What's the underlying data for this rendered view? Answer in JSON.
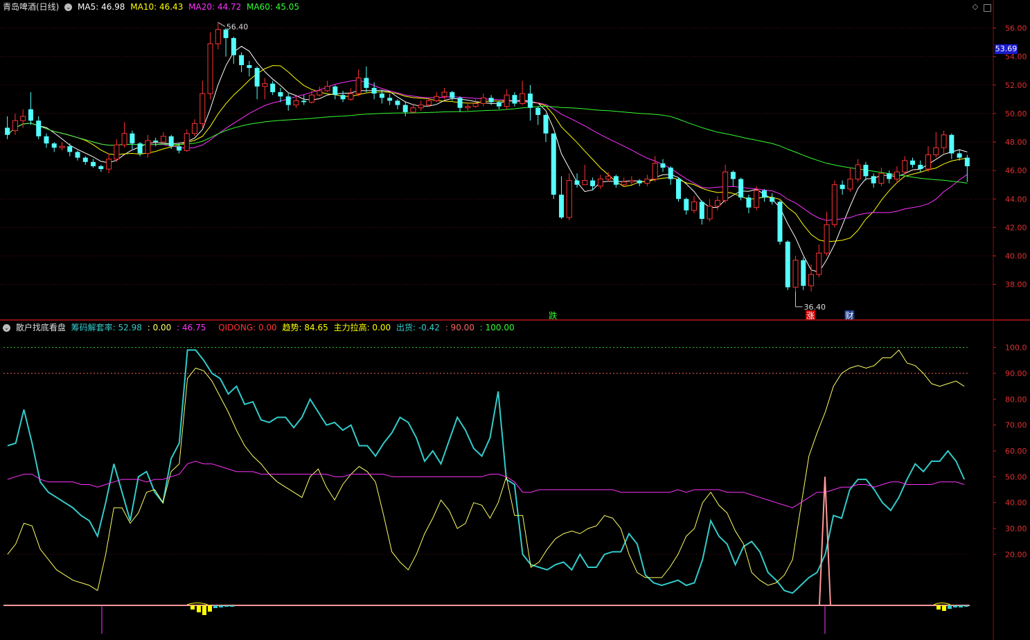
{
  "main": {
    "stock_name": "青岛啤酒(日线)",
    "ma_labels": [
      {
        "text": "MA5: 46.98",
        "color": "#ffffff"
      },
      {
        "text": "MA10: 46.43",
        "color": "#ffff00"
      },
      {
        "text": "MA20: 44.72",
        "color": "#ff33ff"
      },
      {
        "text": "MA60: 45.05",
        "color": "#33ff33"
      }
    ],
    "current_price": "53.69",
    "high_marker": "56.40",
    "low_marker": "36.40",
    "signals": [
      {
        "text": "跌",
        "color": "#33ff33"
      },
      {
        "text": "涨",
        "color": "#ffffff",
        "bg": "#cc0000"
      },
      {
        "text": "财",
        "color": "#ffffff",
        "bg": "#1a3a8a"
      }
    ],
    "y_ticks": [
      "56.00",
      "54.00",
      "52.00",
      "50.00",
      "48.00",
      "46.00",
      "44.00",
      "42.00",
      "40.00",
      "38.00"
    ]
  },
  "indicator": {
    "name": "散户找底看盘",
    "labels": [
      {
        "text": "筹码解套率: 52.98",
        "color": "#33cccc"
      },
      {
        "text": ": 0.00",
        "color": "#ffff66"
      },
      {
        "text": ": 46.75",
        "color": "#ff33ff"
      },
      {
        "text": "QIDONG: 0.00",
        "color": "#ff3333"
      },
      {
        "text": "趋势: 84.65",
        "color": "#ffff00"
      },
      {
        "text": "主力拉高: 0.00",
        "color": "#ffff00"
      },
      {
        "text": "出货: -0.42",
        "color": "#33cccc"
      },
      {
        "text": ": 90.00",
        "color": "#ff6666"
      },
      {
        "text": ": 100.00",
        "color": "#33ff33"
      }
    ],
    "y_ticks": [
      "100.0",
      "90.00",
      "80.00",
      "70.00",
      "60.00",
      "50.00",
      "40.00",
      "30.00",
      "20.00"
    ]
  },
  "chart_data": [
    {
      "type": "candlestick",
      "title": "青岛啤酒(日线)",
      "ylim": [
        35.5,
        57.0
      ],
      "candles": [
        [
          49.0,
          48.5,
          49.8,
          48.2
        ],
        [
          48.8,
          49.5,
          50.0,
          48.5
        ],
        [
          49.5,
          49.8,
          50.3,
          49.0
        ],
        [
          50.3,
          49.5,
          51.5,
          49.2
        ],
        [
          49.5,
          48.4,
          49.8,
          48.2
        ],
        [
          48.4,
          47.9,
          48.6,
          47.6
        ],
        [
          47.9,
          47.6,
          48.0,
          47.3
        ],
        [
          47.6,
          47.7,
          48.0,
          47.4
        ],
        [
          47.7,
          47.3,
          47.9,
          47.0
        ],
        [
          47.3,
          46.9,
          47.4,
          46.7
        ],
        [
          46.9,
          46.6,
          47.0,
          46.4
        ],
        [
          46.6,
          46.3,
          46.8,
          46.2
        ],
        [
          46.3,
          46.1,
          46.4,
          45.9
        ],
        [
          46.1,
          46.8,
          47.2,
          45.8
        ],
        [
          46.8,
          47.8,
          48.2,
          46.6
        ],
        [
          47.8,
          48.6,
          49.4,
          47.6
        ],
        [
          48.6,
          47.9,
          48.8,
          47.5
        ],
        [
          47.9,
          47.2,
          48.0,
          47.0
        ],
        [
          47.2,
          48.1,
          48.5,
          46.9
        ],
        [
          48.1,
          48.0,
          48.3,
          47.7
        ],
        [
          48.0,
          48.4,
          48.7,
          47.8
        ],
        [
          48.4,
          47.7,
          48.5,
          47.5
        ],
        [
          47.7,
          47.4,
          47.9,
          47.2
        ],
        [
          47.4,
          48.6,
          48.9,
          47.3
        ],
        [
          48.6,
          49.3,
          49.6,
          48.4
        ],
        [
          49.3,
          51.4,
          52.3,
          49.0
        ],
        [
          51.4,
          54.9,
          55.7,
          51.0
        ],
        [
          54.9,
          55.9,
          56.4,
          54.5
        ],
        [
          55.9,
          55.3,
          56.0,
          54.0
        ],
        [
          55.3,
          54.1,
          55.4,
          53.5
        ],
        [
          54.1,
          53.4,
          54.3,
          52.9
        ],
        [
          53.4,
          53.2,
          53.7,
          52.6
        ],
        [
          53.2,
          51.9,
          53.3,
          51.0
        ],
        [
          51.9,
          52.1,
          52.5,
          51.0
        ],
        [
          52.1,
          51.5,
          52.3,
          51.3
        ],
        [
          51.5,
          51.2,
          51.8,
          50.8
        ],
        [
          51.2,
          50.6,
          51.4,
          50.2
        ],
        [
          50.6,
          50.9,
          51.2,
          50.4
        ],
        [
          50.9,
          50.8,
          51.3,
          50.6
        ],
        [
          50.8,
          51.3,
          51.6,
          50.7
        ],
        [
          51.3,
          51.6,
          51.9,
          51.2
        ],
        [
          51.6,
          51.9,
          52.3,
          51.5
        ],
        [
          51.9,
          51.3,
          52.0,
          51.0
        ],
        [
          51.3,
          51.0,
          51.6,
          50.8
        ],
        [
          51.0,
          51.4,
          51.8,
          50.9
        ],
        [
          51.4,
          52.5,
          53.1,
          51.2
        ],
        [
          52.5,
          51.8,
          53.3,
          51.5
        ],
        [
          51.8,
          51.4,
          52.2,
          51.0
        ],
        [
          51.4,
          51.1,
          51.6,
          50.7
        ],
        [
          51.1,
          50.9,
          51.4,
          50.6
        ],
        [
          50.9,
          50.6,
          51.0,
          50.3
        ],
        [
          50.6,
          50.1,
          50.8,
          49.8
        ],
        [
          50.1,
          50.4,
          50.7,
          50.0
        ],
        [
          50.4,
          50.6,
          50.9,
          50.2
        ],
        [
          50.6,
          50.9,
          51.1,
          50.5
        ],
        [
          50.9,
          51.2,
          51.5,
          50.8
        ],
        [
          51.2,
          51.5,
          51.8,
          51.0
        ],
        [
          51.5,
          51.1,
          51.6,
          50.9
        ],
        [
          51.1,
          50.4,
          51.2,
          50.1
        ],
        [
          50.4,
          50.5,
          50.8,
          50.2
        ],
        [
          50.5,
          50.7,
          51.0,
          50.4
        ],
        [
          50.7,
          51.1,
          51.4,
          50.5
        ],
        [
          51.1,
          50.8,
          51.3,
          50.6
        ],
        [
          50.8,
          50.5,
          50.9,
          50.3
        ],
        [
          50.5,
          51.3,
          51.7,
          50.3
        ],
        [
          51.3,
          50.7,
          51.5,
          50.5
        ],
        [
          50.7,
          51.4,
          52.3,
          50.6
        ],
        [
          51.4,
          50.4,
          52.0,
          49.5
        ],
        [
          50.4,
          49.9,
          50.5,
          49.2
        ],
        [
          49.9,
          48.6,
          50.0,
          48.0
        ],
        [
          48.6,
          44.3,
          45.0,
          44.0
        ],
        [
          44.3,
          42.7,
          45.6,
          42.6
        ],
        [
          42.7,
          45.3,
          45.8,
          42.5
        ],
        [
          45.3,
          45.0,
          45.8,
          44.8
        ],
        [
          45.0,
          45.3,
          46.4,
          45.0
        ],
        [
          45.3,
          44.9,
          45.5,
          44.6
        ],
        [
          44.9,
          45.4,
          45.7,
          44.7
        ],
        [
          45.4,
          45.6,
          45.9,
          45.2
        ],
        [
          45.6,
          45.0,
          45.7,
          44.8
        ],
        [
          45.0,
          45.2,
          45.5,
          44.9
        ],
        [
          45.2,
          45.3,
          45.6,
          45.0
        ],
        [
          45.3,
          45.1,
          45.4,
          44.9
        ],
        [
          45.1,
          45.4,
          45.7,
          44.9
        ],
        [
          45.4,
          46.5,
          47.0,
          45.2
        ],
        [
          46.5,
          46.2,
          46.8,
          45.9
        ],
        [
          46.2,
          45.4,
          46.3,
          45.0
        ],
        [
          45.4,
          44.0,
          45.5,
          43.8
        ],
        [
          44.0,
          43.2,
          44.1,
          42.9
        ],
        [
          43.2,
          43.8,
          44.2,
          43.0
        ],
        [
          43.8,
          42.6,
          43.9,
          42.2
        ],
        [
          42.6,
          43.5,
          44.0,
          42.4
        ],
        [
          43.5,
          43.9,
          44.2,
          43.2
        ],
        [
          43.9,
          45.9,
          46.4,
          43.7
        ],
        [
          45.9,
          45.4,
          46.0,
          44.9
        ],
        [
          45.4,
          44.1,
          45.5,
          43.9
        ],
        [
          44.1,
          43.4,
          44.3,
          43.0
        ],
        [
          43.4,
          44.6,
          44.9,
          43.2
        ],
        [
          44.6,
          44.1,
          44.7,
          43.8
        ],
        [
          44.1,
          43.8,
          44.4,
          43.6
        ],
        [
          43.8,
          41.0,
          43.9,
          40.8
        ],
        [
          41.0,
          37.8,
          41.1,
          37.6
        ],
        [
          37.8,
          39.7,
          40.0,
          37.5
        ],
        [
          39.7,
          37.9,
          39.9,
          37.6
        ],
        [
          37.9,
          38.7,
          39.4,
          37.5
        ],
        [
          38.7,
          40.2,
          40.8,
          38.5
        ],
        [
          40.2,
          42.2,
          43.1,
          40.0
        ],
        [
          42.2,
          45.0,
          45.3,
          42.0
        ],
        [
          45.0,
          44.7,
          45.3,
          44.3
        ],
        [
          44.7,
          45.4,
          46.2,
          44.5
        ],
        [
          45.4,
          46.4,
          46.8,
          45.2
        ],
        [
          46.4,
          45.6,
          46.6,
          45.3
        ],
        [
          45.6,
          45.1,
          45.8,
          44.8
        ],
        [
          45.1,
          45.8,
          46.2,
          44.9
        ],
        [
          45.8,
          45.4,
          46.0,
          45.1
        ],
        [
          45.4,
          45.9,
          46.3,
          45.1
        ],
        [
          45.9,
          46.7,
          47.0,
          45.7
        ],
        [
          46.7,
          46.4,
          46.9,
          46.2
        ],
        [
          46.4,
          46.1,
          46.7,
          45.9
        ],
        [
          46.1,
          47.1,
          47.7,
          45.9
        ],
        [
          47.1,
          47.6,
          48.7,
          46.9
        ],
        [
          47.6,
          48.5,
          48.8,
          47.2
        ],
        [
          48.5,
          47.2,
          48.6,
          46.8
        ],
        [
          47.2,
          46.9,
          47.5,
          46.7
        ],
        [
          46.9,
          46.3,
          47.1,
          45.2
        ]
      ]
    },
    {
      "type": "line",
      "title": "散户找底看盘",
      "ylim": [
        0,
        105
      ],
      "series": [
        {
          "name": "筹码解套率",
          "values": [
            62,
            63,
            76,
            63,
            48,
            44,
            42,
            40,
            38,
            35,
            33,
            27,
            40,
            55,
            44,
            33,
            50,
            52,
            44,
            40,
            57,
            63,
            99,
            99,
            95,
            90,
            88,
            82,
            85,
            78,
            79,
            72,
            71,
            73,
            73,
            69,
            73,
            80,
            75,
            70,
            71,
            68,
            70,
            62,
            62,
            58,
            63,
            67,
            73,
            71,
            65,
            56,
            60,
            55,
            64,
            73,
            68,
            61,
            58,
            65,
            83,
            49,
            47,
            20,
            16,
            15,
            14,
            16,
            17,
            14,
            20,
            15,
            15,
            20,
            21,
            21,
            28,
            24,
            12,
            9,
            8,
            9,
            10,
            8,
            9,
            18,
            33,
            27,
            24,
            16,
            23,
            25,
            21,
            13,
            10,
            6,
            5,
            8,
            11,
            13,
            20,
            35,
            34,
            45,
            49,
            49,
            45,
            40,
            37,
            42,
            49,
            55,
            52,
            56,
            56,
            60,
            56,
            49
          ]
        },
        {
          "name": "趋势",
          "values": [
            20,
            24,
            32,
            31,
            22,
            18,
            14,
            12,
            10,
            9,
            8,
            6,
            20,
            38,
            38,
            32,
            36,
            44,
            45,
            40,
            52,
            55,
            88,
            92,
            91,
            87,
            81,
            75,
            68,
            62,
            58,
            55,
            51,
            48,
            46,
            44,
            42,
            50,
            53,
            46,
            41,
            47,
            51,
            54,
            52,
            48,
            35,
            21,
            17,
            14,
            20,
            28,
            34,
            41,
            37,
            30,
            32,
            40,
            39,
            34,
            40,
            50,
            35,
            35,
            15,
            17,
            22,
            26,
            28,
            29,
            28,
            30,
            31,
            35,
            34,
            30,
            20,
            13,
            11,
            11,
            11,
            15,
            20,
            27,
            30,
            40,
            44,
            39,
            36,
            29,
            24,
            13,
            10,
            8,
            9,
            12,
            18,
            38,
            58,
            67,
            75,
            85,
            90,
            92,
            93,
            92,
            93,
            96,
            96,
            99,
            94,
            93,
            90,
            86,
            85,
            86,
            87,
            85
          ]
        },
        {
          "name": "MA",
          "values": [
            49,
            50,
            51,
            51,
            49,
            48,
            48,
            48,
            48,
            47,
            47,
            46,
            47,
            48,
            49,
            49,
            49,
            48,
            49,
            49,
            50,
            51,
            55,
            56,
            55,
            55,
            54,
            53,
            52,
            52,
            52,
            51,
            51,
            51,
            51,
            51,
            51,
            51,
            51,
            51,
            50,
            50,
            51,
            51,
            51,
            51,
            51,
            50,
            50,
            50,
            50,
            50,
            50,
            50,
            50,
            50,
            50,
            50,
            50,
            51,
            51,
            50,
            48,
            44,
            44,
            45,
            45,
            45,
            45,
            45,
            45,
            45,
            45,
            45,
            45,
            44,
            44,
            44,
            44,
            44,
            44,
            44,
            45,
            44,
            45,
            45,
            45,
            45,
            44,
            44,
            44,
            43,
            42,
            41,
            40,
            39,
            38,
            40,
            42,
            44,
            44,
            45,
            46,
            46,
            47,
            47,
            46,
            47,
            48,
            48,
            47,
            47,
            47,
            47,
            48,
            48,
            48,
            47
          ]
        }
      ]
    }
  ]
}
